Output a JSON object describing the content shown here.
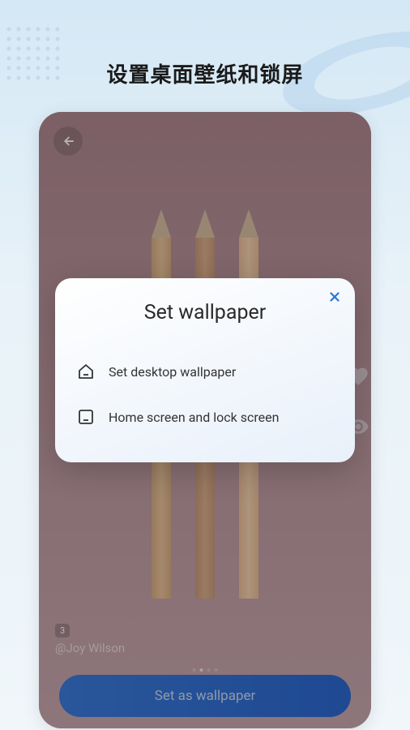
{
  "header": {
    "title": "设置桌面壁纸和锁屏"
  },
  "wallpaper_detail": {
    "comment_count": "3",
    "author": "@Joy Wilson",
    "set_button_label": "Set as wallpaper"
  },
  "dialog": {
    "title": "Set wallpaper",
    "options": [
      {
        "label": "Set desktop wallpaper"
      },
      {
        "label": "Home screen and lock screen"
      }
    ]
  }
}
